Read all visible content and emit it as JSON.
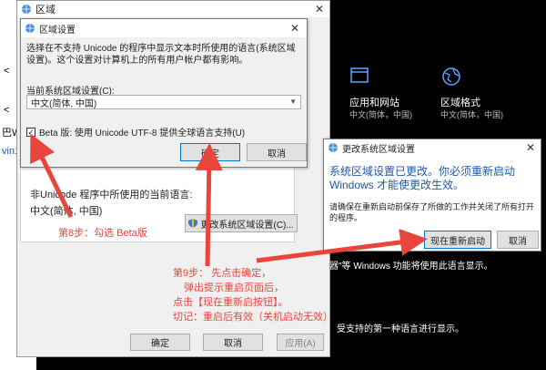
{
  "left_glyphs": [
    "<",
    "<",
    "巴W",
    "vin1"
  ],
  "region_window": {
    "title": "区域",
    "close": "✕",
    "nonunicode_label": "非Unicode 程序中所使用的当前语言:",
    "nonunicode_value": "中文(简体, 中国)",
    "change_locale_button": "更改系统区域设置(C)...",
    "ok": "确定",
    "cancel": "取消",
    "apply": "应用(A)"
  },
  "locale_dialog": {
    "title": "区域设置",
    "close": "✕",
    "description": "选择在不支持 Unicode 的程序中显示文本时所使用的语言(系统区域设置)。这个设置对计算机上的所有用户帐户都有影响。",
    "current_label": "当前系统区域设置(C):",
    "current_value": "中文(简体, 中国)",
    "beta_label": "Beta 版: 使用 Unicode UTF-8 提供全球语言支持(U)",
    "beta_checked": "✓",
    "ok": "确定",
    "cancel": "取消"
  },
  "settings_panel": {
    "item1_title": "应用和网站",
    "item1_sub": "中文(简体，中国)",
    "item2_title": "区域格式",
    "item2_sub": "中文(简体，中国)",
    "line1": "器\"等 Windows 功能将使用此语言显示。",
    "line2": "受支持的第一种语言进行显示。"
  },
  "restart_dialog": {
    "title": "更改系统区域设置",
    "close": "✕",
    "main_text": "系统区域设置已更改。你必须重新启动 Windows 才能使更改生效。",
    "detail_text": "请确保在重新启动前保存了所做的工作并关闭了所有打开的程序。",
    "restart_now": "现在重新启动",
    "cancel": "取消"
  },
  "annotations": {
    "step8": "第8步：勾选 Beta版",
    "step9_line1": "第9步：  先点击确定，",
    "step9_line2": "弹出提示重启页面后，",
    "step9_line3": "点击【现在重新启按钮】。",
    "step9_line4": "切记：重启后有效（关机启动无效）"
  },
  "colors": {
    "annotation": "#e8453c",
    "accent": "#0078d7"
  }
}
